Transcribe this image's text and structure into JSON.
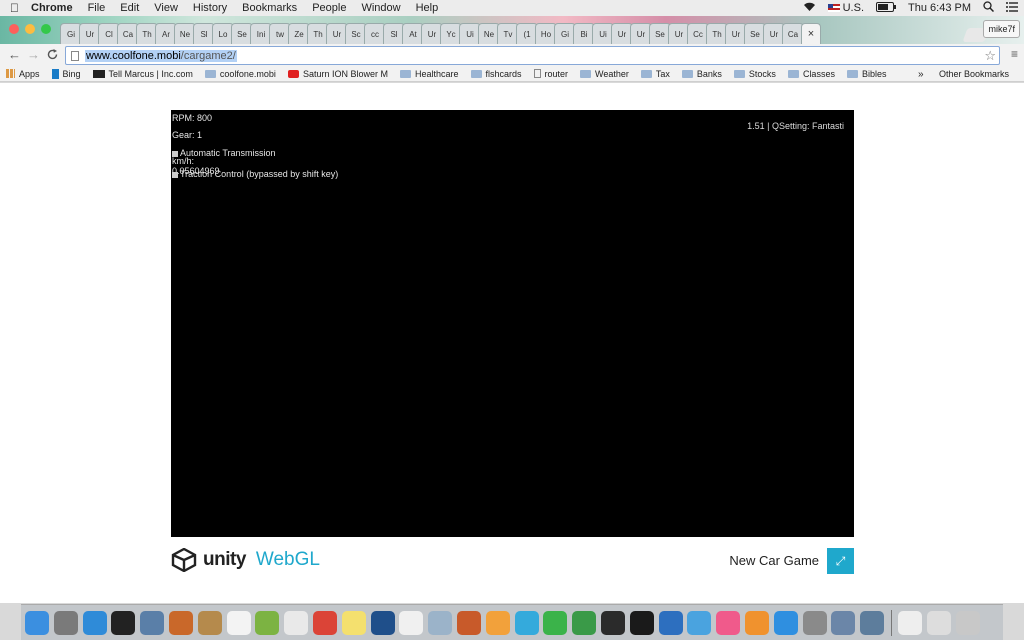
{
  "menubar": {
    "apple": "",
    "app_name": "Chrome",
    "menus": [
      "File",
      "Edit",
      "View",
      "History",
      "Bookmarks",
      "People",
      "Window",
      "Help"
    ],
    "input_source": "U.S.",
    "battery": "⚡",
    "clock": "Thu 6:43 PM"
  },
  "tabs": {
    "labels": [
      "Gi",
      "Ur",
      "Cl",
      "Ca",
      "Th",
      "Ar",
      "Ne",
      "Sl",
      "Lo",
      "Se",
      "Ini",
      "tw",
      "Ze",
      "Th",
      "Ur",
      "Sc",
      "cc",
      "Sl",
      "At",
      "Ur",
      "Yc",
      "Ui",
      "Ne",
      "Tv",
      "(1",
      "Ho",
      "Gi",
      "Bi",
      "Ui",
      "Ur",
      "Ur",
      "Se",
      "Ur",
      "Cc",
      "Th",
      "Ur",
      "Se",
      "Ur",
      "Ca"
    ],
    "active_close": "×",
    "profile_name": "mike7f"
  },
  "toolbar": {
    "back": "←",
    "forward": "→",
    "reload": "C",
    "url_host": "www.coolfone.mobi",
    "url_path": "/cargame2/",
    "star": "☆",
    "menu": "≡"
  },
  "bookmarks": {
    "items": [
      {
        "label": "Apps",
        "icon": "grid"
      },
      {
        "label": "Bing",
        "icon": "bing"
      },
      {
        "label": "Tell Marcus | Inc.com",
        "icon": "inc"
      },
      {
        "label": "coolfone.mobi",
        "icon": "folder"
      },
      {
        "label": "Saturn ION Blower M",
        "icon": "yt"
      },
      {
        "label": "Healthcare",
        "icon": "folder"
      },
      {
        "label": "flshcards",
        "icon": "folder"
      },
      {
        "label": "router",
        "icon": "doc"
      },
      {
        "label": "Weather",
        "icon": "folder"
      },
      {
        "label": "Tax",
        "icon": "folder"
      },
      {
        "label": "Banks",
        "icon": "folder"
      },
      {
        "label": "Stocks",
        "icon": "folder"
      },
      {
        "label": "Classes",
        "icon": "folder"
      },
      {
        "label": "Bibles",
        "icon": "folder"
      }
    ],
    "more": "»",
    "other": "Other Bookmarks"
  },
  "game": {
    "rpm": "RPM: 800",
    "gear": "Gear: 1",
    "auto_transmission": "Automatic Transmission",
    "speed_label": "km/h:",
    "speed_value": "0.05604969",
    "traction": "Traction Control (bypassed by shift key)",
    "version_quality": "1.51 | QSetting: Fantasti"
  },
  "footer": {
    "unity": "unity",
    "webgl": "WebGL",
    "title": "New Car Game",
    "fullscreen_glyph": "⤢"
  },
  "colors": {
    "accent": "#1fa8cc",
    "canvas_bg": "#000000"
  },
  "dock": {
    "icons": [
      {
        "name": "finder",
        "color": "#3b8fe0"
      },
      {
        "name": "launchpad",
        "color": "#7a7a7a"
      },
      {
        "name": "safari",
        "color": "#2f8bd8"
      },
      {
        "name": "terminal",
        "color": "#222222"
      },
      {
        "name": "preview",
        "color": "#5a7fa8"
      },
      {
        "name": "rocket",
        "color": "#c9682a"
      },
      {
        "name": "contacts",
        "color": "#b58a4c"
      },
      {
        "name": "calendar",
        "color": "#f3f3f3"
      },
      {
        "name": "android-studio",
        "color": "#7cb342"
      },
      {
        "name": "textedit",
        "color": "#e9e9e9"
      },
      {
        "name": "chrome",
        "color": "#db4437"
      },
      {
        "name": "notes",
        "color": "#f4e06e"
      },
      {
        "name": "quicktime",
        "color": "#1f4f8a"
      },
      {
        "name": "reminders",
        "color": "#f0f0f0"
      },
      {
        "name": "xcode-utility",
        "color": "#9bb3c9"
      },
      {
        "name": "game-char",
        "color": "#c85a2a"
      },
      {
        "name": "photos",
        "color": "#f2a13b"
      },
      {
        "name": "messages",
        "color": "#34aadc"
      },
      {
        "name": "facetime",
        "color": "#3bb34a"
      },
      {
        "name": "numbers",
        "color": "#3a9a48"
      },
      {
        "name": "activity-monitor",
        "color": "#2b2b2b"
      },
      {
        "name": "unity",
        "color": "#1a1a1a"
      },
      {
        "name": "keynote",
        "color": "#2d6fbf"
      },
      {
        "name": "xcode",
        "color": "#4aa3df"
      },
      {
        "name": "itunes",
        "color": "#f05a8b"
      },
      {
        "name": "ibooks",
        "color": "#f0922e"
      },
      {
        "name": "app-store",
        "color": "#2f8fe0"
      },
      {
        "name": "system-preferences",
        "color": "#8a8a8a"
      },
      {
        "name": "image-capture",
        "color": "#6b86a8"
      },
      {
        "name": "network-utility",
        "color": "#5d7d9c"
      }
    ],
    "right_icons": [
      {
        "name": "document",
        "color": "#eeeeee"
      },
      {
        "name": "documents-stack",
        "color": "#dddddd"
      },
      {
        "name": "trash",
        "color": "#c8c8c8"
      }
    ]
  }
}
